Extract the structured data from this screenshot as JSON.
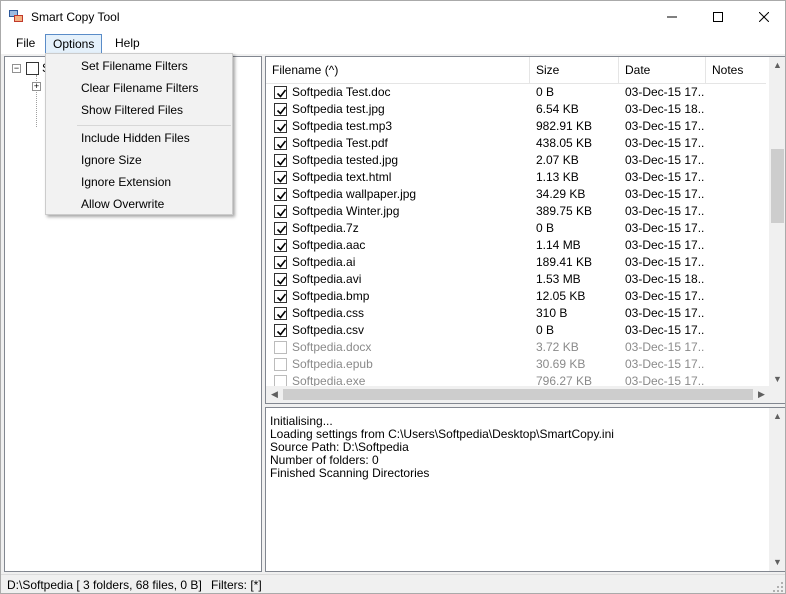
{
  "window": {
    "title": "Smart Copy Tool",
    "minimize_glyph": "—",
    "maximize_glyph": "☐",
    "close_glyph": "✕"
  },
  "menu": {
    "file": "File",
    "options": "Options",
    "help": "Help"
  },
  "options_menu": {
    "items": [
      "Set Filename Filters",
      "Clear Filename Filters",
      "Show Filtered Files",
      "Include Hidden Files",
      "Ignore Size",
      "Ignore Extension",
      "Allow Overwrite"
    ]
  },
  "tree": {
    "root_label": "S"
  },
  "file_list": {
    "columns": [
      "Filename (^)",
      "Size",
      "Date",
      "Notes"
    ],
    "rows": [
      {
        "name": "Softpedia Test.doc",
        "size": "0 B",
        "date": "03-Dec-15 17...",
        "checked": true
      },
      {
        "name": "Softpedia test.jpg",
        "size": "6.54 KB",
        "date": "03-Dec-15 18...",
        "checked": true
      },
      {
        "name": "Softpedia test.mp3",
        "size": "982.91 KB",
        "date": "03-Dec-15 17...",
        "checked": true
      },
      {
        "name": "Softpedia Test.pdf",
        "size": "438.05 KB",
        "date": "03-Dec-15 17...",
        "checked": true
      },
      {
        "name": "Softpedia tested.jpg",
        "size": "2.07 KB",
        "date": "03-Dec-15 17...",
        "checked": true
      },
      {
        "name": "Softpedia text.html",
        "size": "1.13 KB",
        "date": "03-Dec-15 17...",
        "checked": true
      },
      {
        "name": "Softpedia wallpaper.jpg",
        "size": "34.29 KB",
        "date": "03-Dec-15 17...",
        "checked": true
      },
      {
        "name": "Softpedia Winter.jpg",
        "size": "389.75 KB",
        "date": "03-Dec-15 17...",
        "checked": true
      },
      {
        "name": "Softpedia.7z",
        "size": "0 B",
        "date": "03-Dec-15 17...",
        "checked": true
      },
      {
        "name": "Softpedia.aac",
        "size": "1.14 MB",
        "date": "03-Dec-15 17...",
        "checked": true
      },
      {
        "name": "Softpedia.ai",
        "size": "189.41 KB",
        "date": "03-Dec-15 17...",
        "checked": true
      },
      {
        "name": "Softpedia.avi",
        "size": "1.53 MB",
        "date": "03-Dec-15 18...",
        "checked": true
      },
      {
        "name": "Softpedia.bmp",
        "size": "12.05 KB",
        "date": "03-Dec-15 17...",
        "checked": true
      },
      {
        "name": "Softpedia.css",
        "size": "310 B",
        "date": "03-Dec-15 17...",
        "checked": true
      },
      {
        "name": "Softpedia.csv",
        "size": "0 B",
        "date": "03-Dec-15 17...",
        "checked": true
      },
      {
        "name": "Softpedia.docx",
        "size": "3.72 KB",
        "date": "03-Dec-15 17...",
        "checked": false
      },
      {
        "name": "Softpedia.epub",
        "size": "30.69 KB",
        "date": "03-Dec-15 17...",
        "checked": false
      },
      {
        "name": "Softpedia.exe",
        "size": "796.27 KB",
        "date": "03-Dec-15 17...",
        "checked": false
      }
    ]
  },
  "log": {
    "lines": [
      "Initialising...",
      "Loading settings from C:\\Users\\Softpedia\\Desktop\\SmartCopy.ini",
      "Source Path: D:\\Softpedia",
      "Number of folders: 0",
      "Finished Scanning Directories"
    ]
  },
  "status": {
    "path": "D:\\Softpedia [ 3 folders, 68 files, 0 B]",
    "filters": "Filters: [*]"
  },
  "colors": {
    "accent_border": "#5a8cc8",
    "menu_highlight": "#e5f1fb",
    "disabled_text": "#8a8a8a"
  }
}
